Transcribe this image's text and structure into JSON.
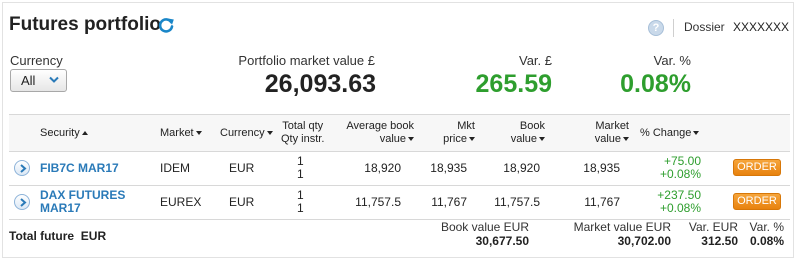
{
  "header": {
    "title": "Futures portfolio",
    "help_glyph": "?",
    "dossier_label": "Dossier",
    "dossier_value": "XXXXXXX"
  },
  "currency": {
    "label": "Currency",
    "selected": "All"
  },
  "stats": {
    "market_value_label": "Portfolio market value £",
    "market_value": "26,093.63",
    "var_label": "Var. £",
    "var_value": "265.59",
    "var_pct_label": "Var. %",
    "var_pct_value": "0.08%"
  },
  "table": {
    "columns": {
      "security": "Security",
      "market": "Market",
      "currency": "Currency",
      "total_qty_line1": "Total qty",
      "total_qty_line2": "Qty instr.",
      "avg_book_line1": "Average book",
      "avg_book_line2": "value",
      "mkt_price_line1": "Mkt",
      "mkt_price_line2": "price",
      "book_value_line1": "Book",
      "book_value_line2": "value",
      "market_value_line1": "Market",
      "market_value_line2": "value",
      "pct_change": "% Change"
    },
    "rows": [
      {
        "security_line1": "FIB7C MAR17",
        "security_line2": "",
        "market": "IDEM",
        "currency": "EUR",
        "total_qty": "1",
        "qty_instr": "1",
        "avg_book_value": "18,920",
        "mkt_price": "18,935",
        "book_value": "18,920",
        "market_value": "18,935",
        "change_abs": "+75.00",
        "change_pct": "+0.08%",
        "order_label": "ORDER"
      },
      {
        "security_line1": "DAX FUTURES",
        "security_line2": "MAR17",
        "market": "EUREX",
        "currency": "EUR",
        "total_qty": "1",
        "qty_instr": "1",
        "avg_book_value": "11,757.5",
        "mkt_price": "11,767",
        "book_value": "11,757.5",
        "market_value": "11,767",
        "change_abs": "+237.50",
        "change_pct": "+0.08%",
        "order_label": "ORDER"
      }
    ]
  },
  "totals": {
    "label": "Total future",
    "currency": "EUR",
    "book_value_label": "Book value  EUR",
    "book_value": "30,677.50",
    "market_value_label": "Market value  EUR",
    "market_value": "30,702.00",
    "var_label": "Var. EUR",
    "var_value": "312.50",
    "var_pct_label": "Var. %",
    "var_pct_value": "0.08%"
  },
  "colors": {
    "positive": "#2e9e2e",
    "link": "#2a7ab8",
    "order_button": "#e8820e"
  },
  "icons": [
    "refresh-icon",
    "help-icon",
    "chevron-down-icon",
    "chevron-right-icon",
    "sort-up-icon",
    "sort-down-icon"
  ]
}
